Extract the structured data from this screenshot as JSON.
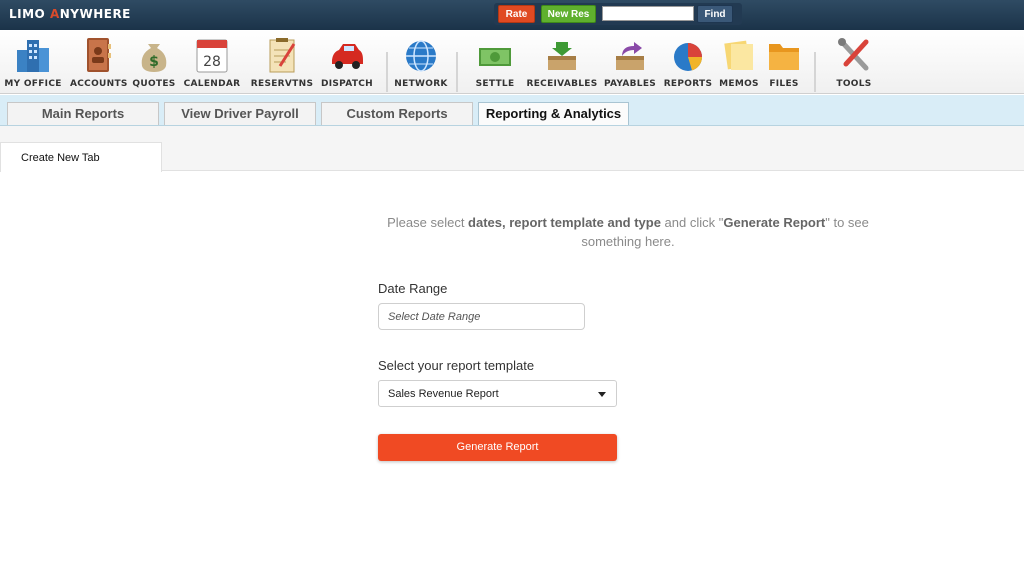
{
  "header": {
    "logo_left": "LIMO ",
    "logo_accent": "A",
    "logo_right": "NYWHERE",
    "rate_label": "Rate",
    "new_res_label": "New Res",
    "search_value": "",
    "find_label": "Find"
  },
  "toolbar": {
    "items": [
      {
        "label": "MY OFFICE",
        "icon": "office-buildings-icon"
      },
      {
        "label": "ACCOUNTS",
        "icon": "address-book-icon"
      },
      {
        "label": "QUOTES",
        "icon": "money-bag-icon"
      },
      {
        "label": "CALENDAR",
        "icon": "calendar-icon",
        "day": "28"
      },
      {
        "label": "RESERVTNS",
        "icon": "notepad-icon"
      },
      {
        "label": "DISPATCH",
        "icon": "red-car-icon"
      },
      {
        "label": "NETWORK",
        "icon": "globe-icon"
      },
      {
        "label": "SETTLE",
        "icon": "cash-icon"
      },
      {
        "label": "RECEIVABLES",
        "icon": "inbox-icon"
      },
      {
        "label": "PAYABLES",
        "icon": "outbox-icon"
      },
      {
        "label": "REPORTS",
        "icon": "pie-chart-icon"
      },
      {
        "label": "MEMOS",
        "icon": "memo-notes-icon"
      },
      {
        "label": "FILES",
        "icon": "folder-icon"
      },
      {
        "label": "TOOLS",
        "icon": "wrench-screwdriver-icon"
      }
    ]
  },
  "report_tabs": [
    {
      "label": "Main Reports",
      "active": false
    },
    {
      "label": "View Driver Payroll",
      "active": false
    },
    {
      "label": "Custom Reports",
      "active": false
    },
    {
      "label": "Reporting & Analytics",
      "active": true
    }
  ],
  "sub_tab": {
    "label": "Create New Tab"
  },
  "content": {
    "prompt_1": "Please select ",
    "prompt_bold_1": "dates, report template and type",
    "prompt_2": " and click \"",
    "prompt_bold_2": "Generate Report",
    "prompt_3": "\" to see something here.",
    "date_range_label": "Date Range",
    "date_range_placeholder": "Select Date Range",
    "template_label": "Select your report template",
    "template_selected": "Sales Revenue Report",
    "generate_label": "Generate Report"
  },
  "colors": {
    "header_bg": "#1b3349",
    "rate": "#e04a22",
    "new_res": "#5fb02e",
    "find": "#3a5878",
    "tab_bar": "#d9edf7",
    "generate_button": "#f04a23"
  }
}
